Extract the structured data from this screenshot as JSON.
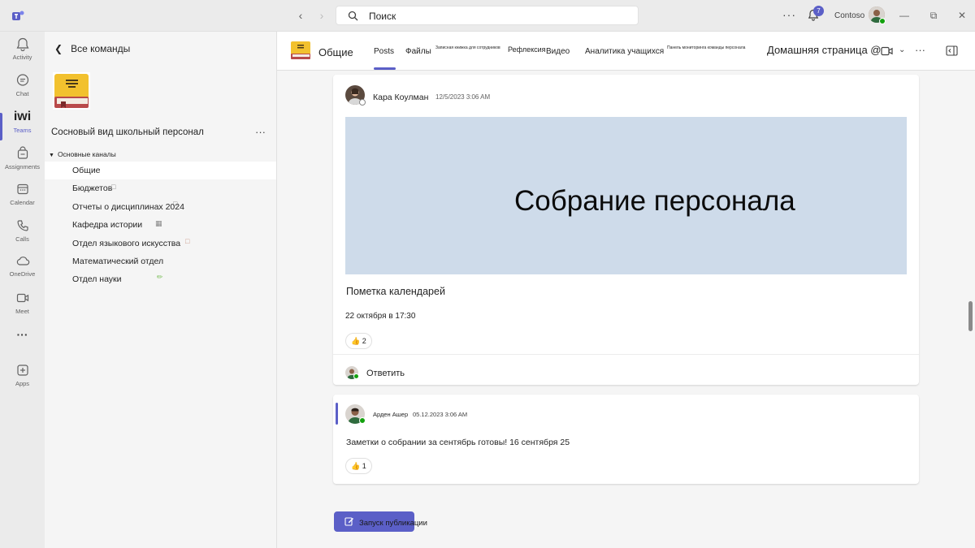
{
  "titlebar": {
    "search_placeholder": "Поиск",
    "more": "···",
    "notifications_count": "7",
    "org_name": "Contoso"
  },
  "rail": {
    "items": [
      {
        "label": "Activity",
        "icon": "bell-icon"
      },
      {
        "label": "Chat",
        "icon": "chat-icon"
      },
      {
        "label": "Teams",
        "icon": "teams-icon",
        "glyph": "iwi"
      },
      {
        "label": "Assignments",
        "icon": "assignments-icon"
      },
      {
        "label": "Calendar",
        "icon": "calendar-icon"
      },
      {
        "label": "Calls",
        "icon": "phone-icon"
      },
      {
        "label": "OneDrive",
        "icon": "cloud-icon"
      },
      {
        "label": "Meet",
        "icon": "video-icon"
      },
      {
        "label": "···",
        "icon": "more-icon"
      },
      {
        "label": "Apps",
        "icon": "apps-icon"
      }
    ]
  },
  "teampane": {
    "back_label": "Все команды",
    "team_name": "Сосновый вид школьный персонал",
    "more": "···",
    "section_label": "Основные каналы",
    "channels": [
      {
        "label": "Общие"
      },
      {
        "label": "Бюджетов"
      },
      {
        "label": "Отчеты о дисциплинах 2024"
      },
      {
        "label": "Кафедра истории"
      },
      {
        "label": "Отдел языкового искусства"
      },
      {
        "label": "Математический отдел"
      },
      {
        "label": "Отдел науки"
      }
    ]
  },
  "header": {
    "title": "Общие",
    "tabs": {
      "posts": "Posts",
      "files": "Файлы",
      "notebook": "Записная книжка для сотрудников",
      "reflect": "Рефлексия",
      "video": "Видео",
      "insights": "Аналитика учащихся",
      "monitor": "Панель мониторинга команды персонала",
      "home": "Домашняя страница @"
    },
    "more": "···"
  },
  "posts": [
    {
      "author": "Кара Коулман",
      "time": "12/5/2023 3:06 AM",
      "banner_text": "Собрание персонала",
      "subject": "Пометка календарей",
      "body": "22 октября в 17:30",
      "reaction_count": "2",
      "reply_label": "Ответить"
    },
    {
      "author": "Арден Ашер",
      "time": "05.12.2023 3:06 AM",
      "body": "Заметки о собрании за сентябрь готовы! 16 сентября 25",
      "reaction_count": "1"
    }
  ],
  "compose": {
    "new_post_label": "Запуск публикации"
  },
  "colors": {
    "accent": "#5b5fc7",
    "banner": "#cedbea",
    "presence": "#13a10e",
    "team_icon_yellow": "#f2c12e"
  }
}
